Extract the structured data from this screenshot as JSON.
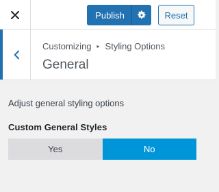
{
  "header": {
    "publish_label": "Publish",
    "reset_label": "Reset"
  },
  "section": {
    "breadcrumb_root": "Customizing",
    "breadcrumb_parent": "Styling Options",
    "breadcrumb_separator": "▸",
    "title": "General"
  },
  "panel": {
    "description": "Adjust general styling options",
    "control_label": "Custom General Styles",
    "options": [
      "Yes",
      "No"
    ],
    "selected": "No"
  },
  "colors": {
    "primary": "#2271b1",
    "toggle_active": "#0095d9",
    "toggle_inactive": "#dcdcde",
    "panel_bg": "#f1f1f1"
  },
  "icons": {
    "close": "close-icon",
    "settings": "gear-icon",
    "back": "chevron-left-icon"
  }
}
